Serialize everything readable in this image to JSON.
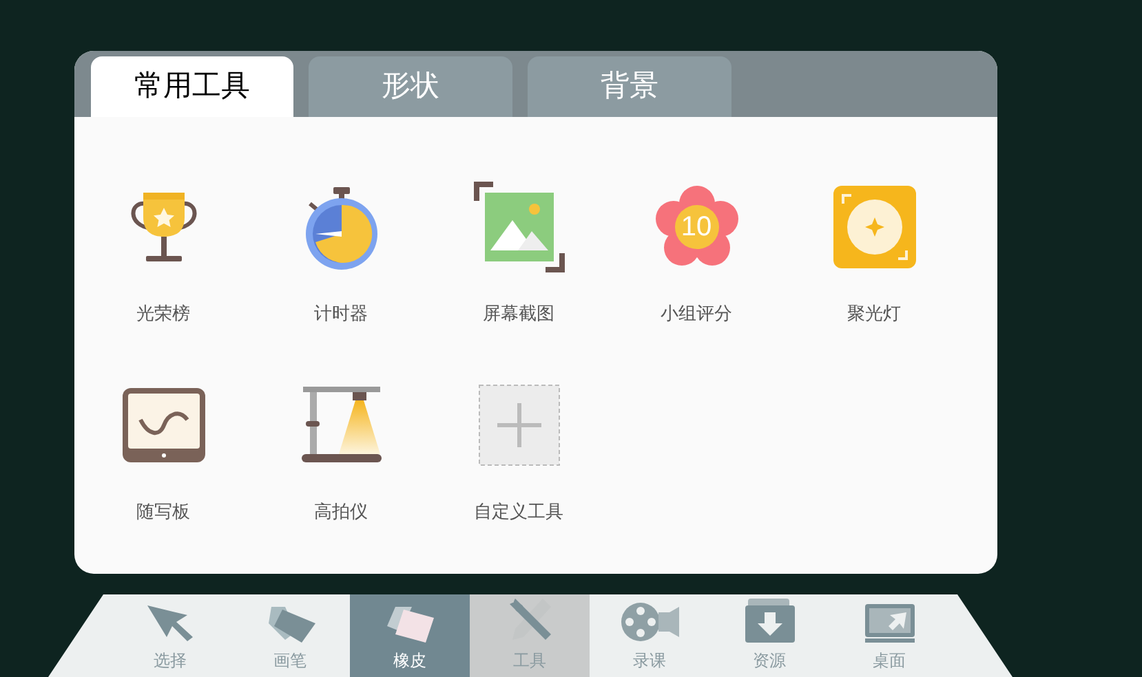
{
  "tabs": [
    {
      "label": "常用工具",
      "selected": true
    },
    {
      "label": "形状",
      "selected": false
    },
    {
      "label": "背景",
      "selected": false
    }
  ],
  "tools": [
    {
      "label": "光荣榜"
    },
    {
      "label": "计时器"
    },
    {
      "label": "屏幕截图"
    },
    {
      "label": "小组评分",
      "badge": "10"
    },
    {
      "label": "聚光灯"
    },
    {
      "label": "随写板"
    },
    {
      "label": "高拍仪"
    },
    {
      "label": "自定义工具"
    }
  ],
  "toolbar": [
    {
      "label": "选择",
      "selected": false,
      "highlighted": false
    },
    {
      "label": "画笔",
      "selected": false,
      "highlighted": false
    },
    {
      "label": "橡皮",
      "selected": true,
      "highlighted": false
    },
    {
      "label": "工具",
      "selected": false,
      "highlighted": true
    },
    {
      "label": "录课",
      "selected": false,
      "highlighted": false
    },
    {
      "label": "资源",
      "selected": false,
      "highlighted": false
    },
    {
      "label": "桌面",
      "selected": false,
      "highlighted": false
    }
  ]
}
